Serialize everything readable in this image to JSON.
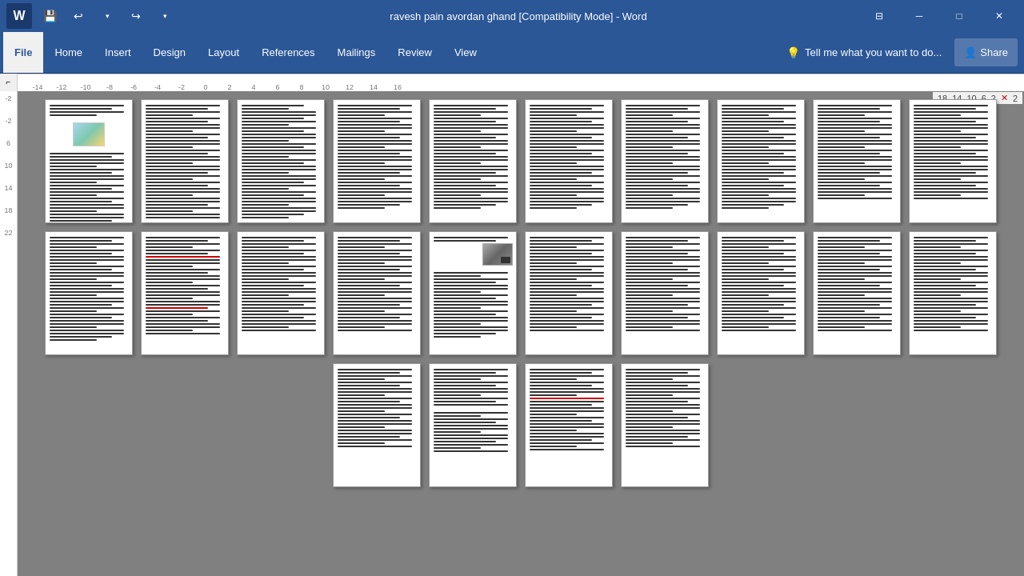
{
  "titlebar": {
    "title": "ravesh pain avordan ghand [Compatibility Mode] - Word",
    "save_icon": "💾",
    "undo_icon": "↩",
    "redo_icon": "↪",
    "minimize_label": "─",
    "restore_label": "□",
    "close_label": "✕"
  },
  "ribbon": {
    "tabs": [
      {
        "id": "file",
        "label": "File"
      },
      {
        "id": "home",
        "label": "Home"
      },
      {
        "id": "insert",
        "label": "Insert"
      },
      {
        "id": "design",
        "label": "Design"
      },
      {
        "id": "layout",
        "label": "Layout"
      },
      {
        "id": "references",
        "label": "References"
      },
      {
        "id": "mailings",
        "label": "Mailings"
      },
      {
        "id": "review",
        "label": "Review"
      },
      {
        "id": "view",
        "label": "View"
      }
    ],
    "tell_me_placeholder": "Tell me what you want to do...",
    "share_label": "Share"
  },
  "zoom": {
    "levels": [
      "18",
      "14",
      "10",
      "6",
      "2",
      "×2"
    ]
  },
  "ruler": {
    "v_numbers": [
      "-2",
      "-2",
      "6",
      "10",
      "14",
      "18",
      "22"
    ],
    "h_numbers": [
      "-14",
      "-12",
      "-10",
      "-8",
      "-6",
      "-4",
      "-2",
      "0",
      "2",
      "4",
      "6",
      "8",
      "10",
      "12",
      "14",
      "16"
    ]
  }
}
